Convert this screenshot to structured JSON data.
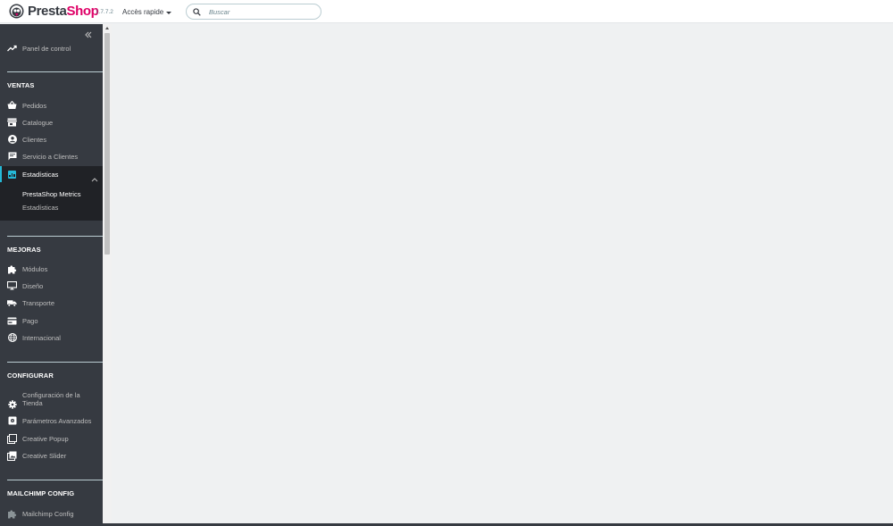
{
  "header": {
    "logo": {
      "part1": "Presta",
      "part2": "Shop"
    },
    "version": "1.7.7.2",
    "quick_access": "Accès rapide",
    "search_placeholder": "Buscar"
  },
  "sidebar": {
    "dashboard": "Panel de control",
    "sections": [
      {
        "title": "VENTAS"
      },
      {
        "title": "MEJORAS"
      },
      {
        "title": "CONFIGURAR"
      },
      {
        "title": "MAILCHIMP CONFIG"
      }
    ],
    "ventas_items": [
      {
        "label": "Pedidos",
        "icon": "basket-icon"
      },
      {
        "label": "Catalogue",
        "icon": "store-icon"
      },
      {
        "label": "Clientes",
        "icon": "account-circle-icon"
      },
      {
        "label": "Servicio a Clientes",
        "icon": "chat-icon"
      },
      {
        "label": "Estadísticas",
        "icon": "bar-chart-icon",
        "active": true
      }
    ],
    "estadisticas_sub": [
      {
        "label": "PrestaShop Metrics",
        "current": true
      },
      {
        "label": "Estadísticas",
        "current": false
      }
    ],
    "mejoras_items": [
      {
        "label": "Módulos",
        "icon": "puzzle-icon"
      },
      {
        "label": "Diseño",
        "icon": "desktop-icon"
      },
      {
        "label": "Transporte",
        "icon": "truck-icon"
      },
      {
        "label": "Pago",
        "icon": "credit-card-icon"
      },
      {
        "label": "Internacional",
        "icon": "globe-icon"
      }
    ],
    "configurar_items": [
      {
        "label": "Configuración de la Tienda",
        "line1": "Configuración de la",
        "line2": "Tienda",
        "icon": "gear-icon"
      },
      {
        "label": "Parámetros Avanzados",
        "icon": "settings-box-icon"
      },
      {
        "label": "Creative Popup",
        "icon": "layers-icon"
      },
      {
        "label": "Creative Slider",
        "icon": "image-icon"
      }
    ],
    "mailchimp_items": [
      {
        "label": "Mailchimp Config",
        "icon": "puzzle-icon"
      }
    ]
  },
  "colors": {
    "sidebar_bg": "#363a41",
    "active_bg": "#202226",
    "accent": "#25b9d7",
    "brand_pink": "#df0067",
    "content_bg": "#eff1f2"
  }
}
